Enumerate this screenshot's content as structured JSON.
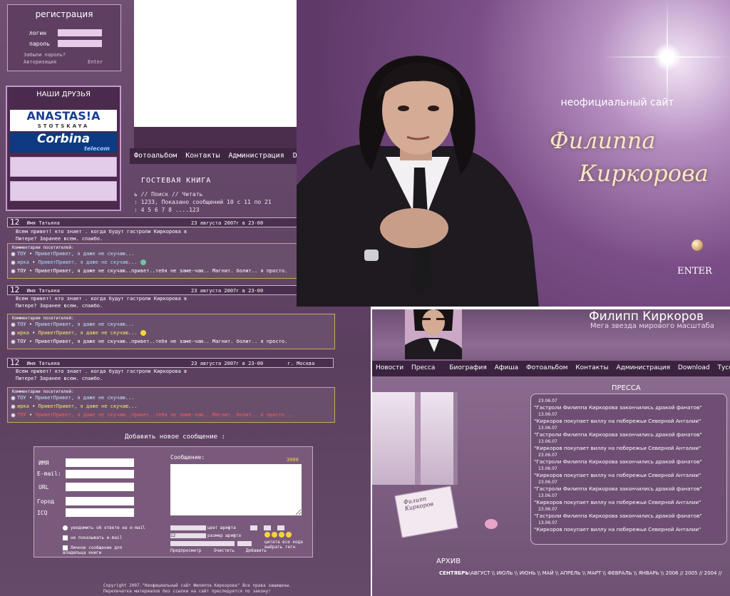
{
  "guestbook": {
    "registration": {
      "title": "регистрация",
      "login_label": "логин",
      "password_label": "пароль",
      "forgot": "Забыли пароль?",
      "auth": "Авторизация",
      "enter": "Enter"
    },
    "friends": {
      "title": "НАШИ ДРУЗЬЯ",
      "logo1_main": "ANASTAS!A",
      "logo1_sub": "STOTSKAYA",
      "logo2_main": "Corbina",
      "logo2_sub": "telecom"
    },
    "nav": [
      "Фотоальбом",
      "Контакты",
      "Администрация",
      "D"
    ],
    "title": "ГОСТЕВАЯ КНИГА",
    "breadcrumb": "ь // Поиск // Читать",
    "stats": ": 1233, Показано сообщений 10 с 11 по 21",
    "pages": ": 4 5 6 7 8 ....123",
    "posts": [
      {
        "num": "12",
        "name": "Имя Татьяна",
        "date": "23 августа 2007г в 23-00",
        "city": "",
        "line1": "Всем привет! кто знает . когда будут гастроли Киркорова в",
        "line2": "Питере? Заранее всем. спаибо.",
        "comments_caption": "Комментарии посетителей:",
        "comments": [
          {
            "author": "ТОУ",
            "text": "ПриветПривет, я даже не скучаю...",
            "color": "#bfe0ff"
          },
          {
            "author": "ирка",
            "text": "ПриветПривет, я даже не скучаю...",
            "color": "#9dd8ff"
          },
          {
            "author": "ТОУ",
            "text": "ПриветПривет, я даже не скучаю..привет..тебя не заме-чаю.. Магнит. болит.. я просто.",
            "color": "#ffffff"
          }
        ]
      },
      {
        "num": "12",
        "name": "Имя Татьяна",
        "date": "23 августа 2007г в 23-00",
        "city": "",
        "line1": "Всем привет! кто знает . когда будут гастроли Киркорова в",
        "line2": "Питере? Заранее всем. спаибо.",
        "comments_caption": "Комментарии посетителей:",
        "comments": [
          {
            "author": "ТОУ",
            "text": "ПриветПривет, я даже не скучаю...",
            "color": "#bfe0ff"
          },
          {
            "author": "ирка",
            "text": "ПриветПривет, я даже не скучаю...",
            "color": "#f3e56c"
          },
          {
            "author": "ТОУ",
            "text": "ПриветПривет, я даже не скучаю..привет..тебя не заме-чаю.. Магнит. болит.. я просто.",
            "color": "#ffffff"
          }
        ]
      },
      {
        "num": "12",
        "name": "Имя Татьяна",
        "date": "23 августа 2007г в 23-00",
        "city": "г. Москва",
        "line1": "Всем привет! кто знает . когда будут гастроли Киркорова в",
        "line2": "Питере? Заранее всем. спаибо.",
        "comments_caption": "Комментарии посетителей:",
        "comments": [
          {
            "author": "ТОУ",
            "text": "ПриветПривет, я даже не скучаю...",
            "color": "#bfe0ff"
          },
          {
            "author": "ирка",
            "text": "ПриветПривет, я даже не скучаю...",
            "color": "#f3e56c"
          },
          {
            "author": "ТОУ",
            "text": "ПриветПривет, я даже не скучаю..привет..тебя не заме-чаю.. Магнит. болит.. я просто ..",
            "color": "#ff5a5a"
          }
        ]
      }
    ],
    "add_title": "Добавить новое сообщение :",
    "form": {
      "name": "ИМЯ",
      "email": "E-mail:",
      "url": "URL",
      "city": "Город",
      "icq": "ICQ",
      "message": "Сообщение:",
      "counter": "3000",
      "opt1": "уведомить об ответе на e-mail",
      "opt2": "не показывать e-mail",
      "opt3": "Личное сообщение для владельца книги",
      "font_color": "цвет шрифта",
      "font_size": "размер шрифта",
      "quote": "цитата",
      "all_smiles": "все кода",
      "choose": "выбрать тегн",
      "preview": "Предпросмотр",
      "clear": "Очистить",
      "add": "Добавить",
      "size_value": "12"
    },
    "footer1": "Copyright 2007.\"Неофициальный сайт Филиппа Киркорова\" Все права защищены.",
    "footer2": "Перепечатка материалов без ссылки на сайт преследуется по закону!"
  },
  "hero": {
    "unofficial": "неофициальный сайт",
    "name1": "Филиппа",
    "name2": "Киркорова",
    "enter": "ENTER"
  },
  "press": {
    "header_name": "Филипп Киркоров",
    "tagline": "Мега звезда мирового масштаба",
    "nav": [
      "Новости",
      "Пресса",
      "Биография",
      "Афиша",
      "Фотоальбом",
      "Контакты",
      "Администрация",
      "Download",
      "Тусо"
    ],
    "title": "ПРЕССА",
    "items": [
      {
        "date": "23.06.07",
        "text": "\"Гастроли Филиппа Киркорова закончились дракой фанатов\""
      },
      {
        "date": "13.06.07",
        "text": "\"Киркоров покупает виллу на побережьи Северной Анталии\""
      },
      {
        "date": "13.06.07",
        "text": "\"Гастроли Филиппа Киркорова закончились дракой фанатов\""
      },
      {
        "date": "13.06.07",
        "text": "\"Киркоров покупает виллу на побережьи Северной Анталии\""
      },
      {
        "date": "23.06.07",
        "text": "\"Гастроли Филиппа Киркорова закончились дракой фанатов\""
      },
      {
        "date": "13.06.07",
        "text": "\"Киркоров покупает виллу на побережьи Северной Анталии\""
      },
      {
        "date": "23.06.07",
        "text": "\"Гастроли Филиппа Киркорова закончились дракой фанатов\""
      },
      {
        "date": "13.06.07",
        "text": "\"Киркоров покупает виллу на побережьи Северной Анталии\""
      },
      {
        "date": "23.06.07",
        "text": "\"Гастроли Филиппа Киркорова закончились дракой фанатов\""
      },
      {
        "date": "13.06.07",
        "text": "\"Киркоров покупает виллу на побережьи Северной Анталии\""
      }
    ],
    "archive_title": "АРХИВ",
    "archive_current": "СЕНТЯБРЬ",
    "archive_rest": "\\АВГУСТ \\\\ ИЮЛЬ \\\\ ИЮНЬ \\\\ МАЙ \\\\ АПРЕЛЬ \\\\ МАРТ \\\\ ФЕВРАЛЬ \\\\ ЯНВАРЬ \\\\  2006 // 2005 // 2004 //",
    "book_title": "Филипп Киркоров"
  }
}
